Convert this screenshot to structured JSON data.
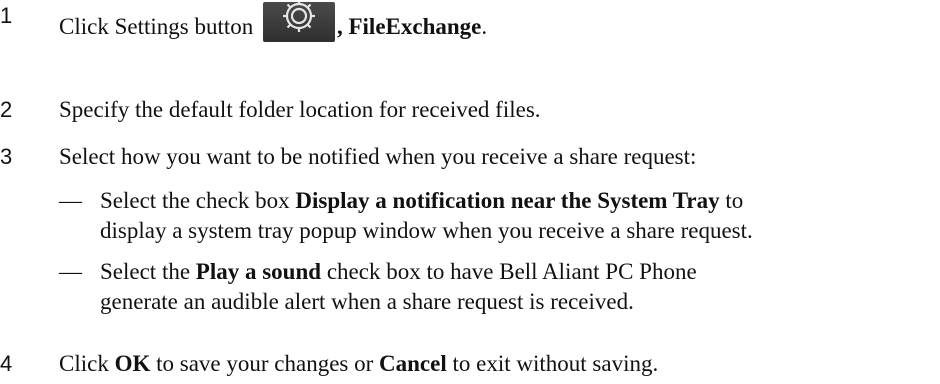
{
  "steps": [
    {
      "num": "1",
      "pre": "Click Settings button ",
      "bold": ", FileExchange",
      "post": "."
    },
    {
      "num": "2",
      "text": "Specify the default folder location for received files."
    },
    {
      "num": "3",
      "text": "Select how you want to be notified when you receive a share request:"
    },
    {
      "num": "4",
      "pre": "Click ",
      "bold1": "OK",
      "mid": " to save your changes or ",
      "bold2": "Cancel",
      "post": " to exit without saving."
    }
  ],
  "substeps": [
    {
      "dash": "—",
      "line1_pre": "Select the check box ",
      "line1_bold": "Display a notification near the System Tray",
      "line1_post": " to",
      "line2": "display a system tray popup window when you receive a share request."
    },
    {
      "dash": "—",
      "line1_pre": "Select the ",
      "line1_bold": "Play a sound",
      "line1_post": " check box to have Bell Aliant PC Phone",
      "line2": "generate an audible alert when a share request is received."
    }
  ],
  "icons": {
    "settings": "gear-icon"
  }
}
